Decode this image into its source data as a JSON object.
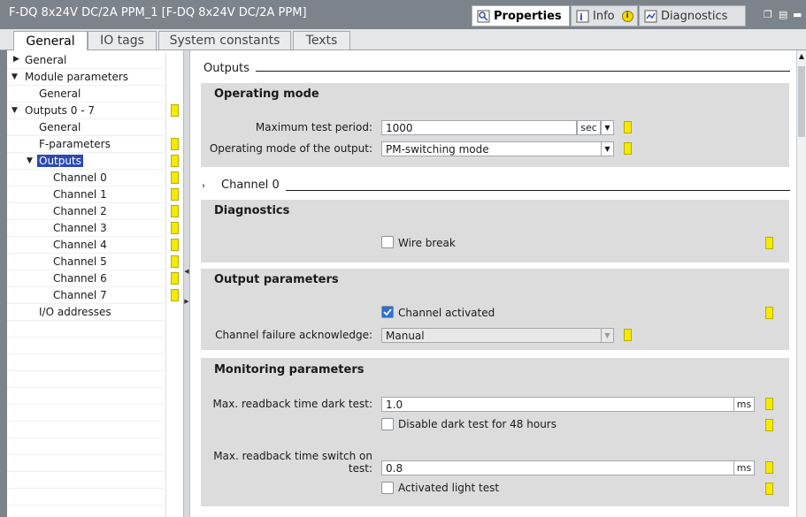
{
  "window": {
    "title": "F-DQ 8x24V DC/2A PPM_1 [F-DQ 8x24V DC/2A PPM]",
    "panel_tabs": [
      {
        "label": "Properties",
        "icon": "properties-icon"
      },
      {
        "label": "Info",
        "icon": "info-icon"
      },
      {
        "label": "Diagnostics",
        "icon": "diagnostics-icon"
      }
    ]
  },
  "tabs": [
    "General",
    "IO tags",
    "System constants",
    "Texts"
  ],
  "tree": [
    {
      "label": "General",
      "expanded": false,
      "flag": false
    },
    {
      "label": "Module parameters",
      "expanded": true,
      "flag": false
    },
    {
      "label": "General",
      "flag": false
    },
    {
      "label": "Outputs 0 - 7",
      "expanded": true,
      "flag": true
    },
    {
      "label": "General",
      "flag": false
    },
    {
      "label": "F-parameters",
      "flag": true
    },
    {
      "label": "Outputs",
      "expanded": true,
      "selected": true,
      "flag": true
    },
    {
      "label": "Channel 0",
      "flag": true
    },
    {
      "label": "Channel 1",
      "flag": true
    },
    {
      "label": "Channel 2",
      "flag": true
    },
    {
      "label": "Channel 3",
      "flag": true
    },
    {
      "label": "Channel 4",
      "flag": true
    },
    {
      "label": "Channel 5",
      "flag": true
    },
    {
      "label": "Channel 6",
      "flag": true
    },
    {
      "label": "Channel 7",
      "flag": true
    },
    {
      "label": "I/O addresses",
      "flag": false
    }
  ],
  "content": {
    "outputs_header": "Outputs",
    "operating_mode": {
      "title": "Operating mode",
      "max_test_period_label": "Maximum test period:",
      "max_test_period_value": "1000",
      "max_test_period_unit": "sec",
      "op_mode_label": "Operating mode of the output:",
      "op_mode_value": "PM-switching mode"
    },
    "channel_header": "Channel 0",
    "diagnostics": {
      "title": "Diagnostics",
      "wire_break_label": "Wire break",
      "wire_break_checked": false
    },
    "output_parameters": {
      "title": "Output parameters",
      "channel_activated_label": "Channel activated",
      "channel_activated_checked": true,
      "failure_ack_label": "Channel failure acknowledge:",
      "failure_ack_value": "Manual"
    },
    "monitoring_parameters": {
      "title": "Monitoring parameters",
      "dark_test_label": "Max. readback time dark test:",
      "dark_test_value": "1.0",
      "dark_test_unit": "ms",
      "disable_dark_label": "Disable dark test for 48 hours",
      "disable_dark_checked": false,
      "switch_on_label_1": "Max. readback time switch on",
      "switch_on_label_2": "test:",
      "switch_on_value": "0.8",
      "switch_on_unit": "ms",
      "light_test_label": "Activated light test",
      "light_test_checked": false
    }
  },
  "colors": {
    "titlebar": "#7d838a",
    "section_bg": "#dcdcdc",
    "flag_yellow": "#f5ea00",
    "selection_blue": "#2a4ab0",
    "checkbox_blue": "#2a6fd6"
  }
}
